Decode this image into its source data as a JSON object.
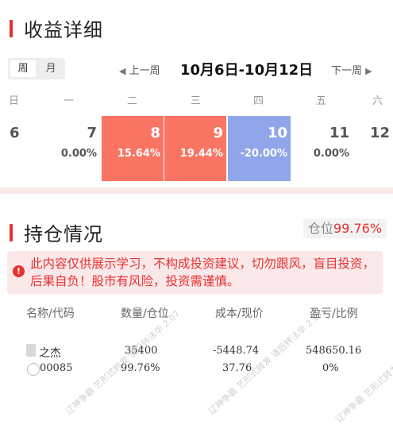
{
  "earnings": {
    "title": "收益详细",
    "tabs": [
      "周",
      "月"
    ],
    "prev_label": "上一周",
    "next_label": "下一周",
    "date_range": "10月6日-10月12日",
    "weekdays": [
      "日",
      "一",
      "二",
      "三",
      "四",
      "五",
      "六"
    ],
    "days": [
      {
        "date": "6",
        "pct": ""
      },
      {
        "date": "7",
        "pct": "0.00%"
      },
      {
        "date": "8",
        "pct": "15.64%"
      },
      {
        "date": "9",
        "pct": "19.44%"
      },
      {
        "date": "10",
        "pct": "-20.00%"
      },
      {
        "date": "11",
        "pct": "0.00%"
      },
      {
        "date": "12",
        "pct": ""
      }
    ]
  },
  "holdings": {
    "title": "持仓情况",
    "position_label": "仓位",
    "position_value": "99.76%",
    "notice": "此内容仅供展示学习，不构成投资建议，切勿跟风，盲目投资，后果自负！股市有风险，投资需谨慎。",
    "headers": [
      "名称/代码",
      "数量/仓位",
      "成本/现价",
      "盈亏/比例"
    ],
    "rows": [
      {
        "name": "之杰",
        "code": "00085",
        "qty": "35400",
        "ratio": "99.76%",
        "cost": "-5448.74",
        "price": "37.76",
        "pnl": "548650.16",
        "pnl_pct": "0%"
      }
    ],
    "watermark": "辽神争霸 艺形式转发 请后转法华 2.07"
  },
  "colors": {
    "accent": "#e8302e",
    "up": "#f97462",
    "down": "#90a5ea",
    "band": "#fbe9ea"
  }
}
